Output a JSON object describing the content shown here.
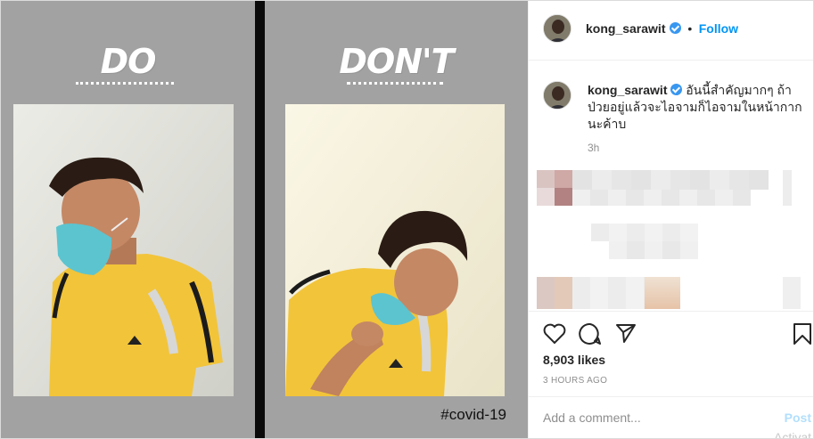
{
  "media": {
    "left_heading": "DO",
    "right_heading": "DON'T",
    "hashtag": "#covid-19"
  },
  "header": {
    "username": "kong_sarawit",
    "separator": "•",
    "follow_label": "Follow"
  },
  "caption": {
    "username": "kong_sarawit",
    "text": "อันนี้สำคัญมากๆ ถ้าป่วยอยู่แล้วจะไอจามก็ไอจามในหน้ากากนะค้าบ",
    "time": "3h"
  },
  "actions": {
    "like_icon": "heart-icon",
    "comment_icon": "comment-icon",
    "share_icon": "paper-plane-icon",
    "save_icon": "bookmark-icon",
    "likes": "8,903 likes",
    "posted_ago": "3 HOURS AGO"
  },
  "comment_box": {
    "placeholder": "Add a comment...",
    "post_label": "Post"
  },
  "overlay": {
    "watermark": "Activat"
  },
  "colors": {
    "accent": "#0095f6",
    "verified": "#3897f0",
    "shirt_yellow": "#f2c43a",
    "mask_teal": "#5cc4cf"
  }
}
